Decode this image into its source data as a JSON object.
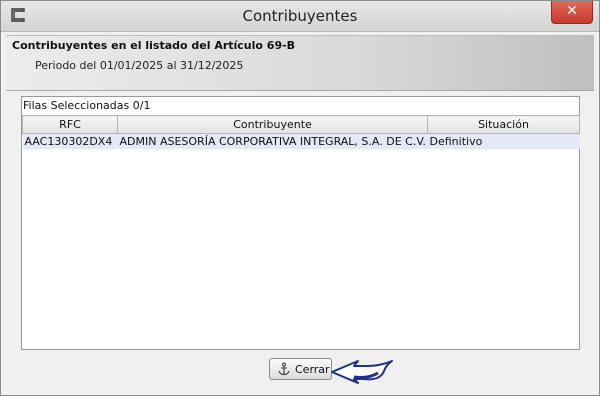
{
  "window": {
    "title": "Contribuyentes",
    "close_glyph": "✕"
  },
  "header": {
    "title": "Contribuyentes en el listado del Artículo 69-B",
    "subtitle": "Periodo del 01/01/2025 al 31/12/2025"
  },
  "grid": {
    "selection_label": "Filas Seleccionadas",
    "selection_count": "0/1",
    "columns": [
      "RFC",
      "Contribuyente",
      "Situación"
    ],
    "rows": [
      [
        "AAC130302DX4",
        "ADMIN ASESORÍA CORPORATIVA INTEGRAL, S.A. DE C.V.",
        "Definitivo"
      ]
    ]
  },
  "footer": {
    "close_label": "Cerrar",
    "close_icon": "anchor-icon"
  },
  "annotation": {
    "icon": "curved-arrow-icon",
    "color": "#1f2f8f"
  }
}
